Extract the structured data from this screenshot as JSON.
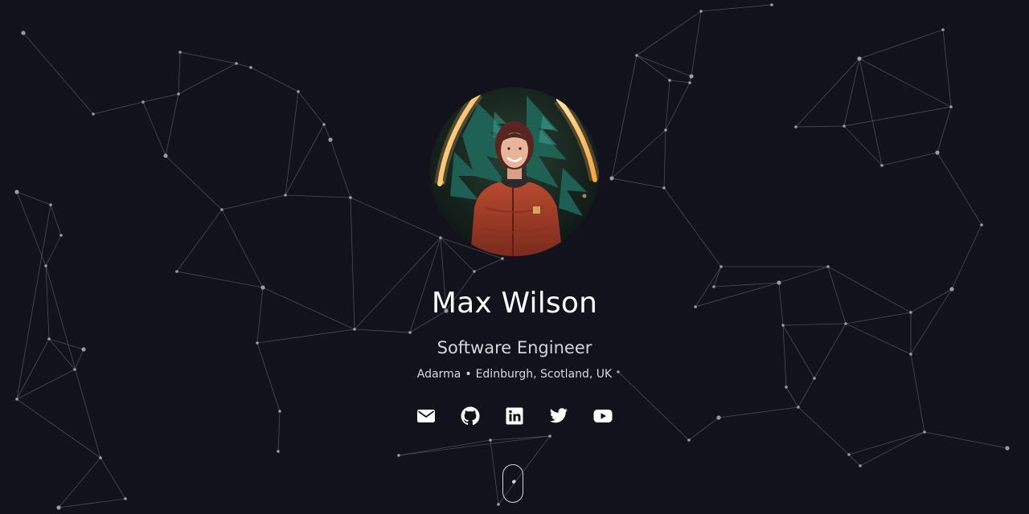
{
  "profile": {
    "name": "Max Wilson",
    "title": "Software Engineer",
    "company": "Adarma",
    "separator": "•",
    "location": "Edinburgh, Scotland, UK"
  },
  "social_links": [
    {
      "icon": "envelope-icon",
      "label": "Email"
    },
    {
      "icon": "github-icon",
      "label": "GitHub"
    },
    {
      "icon": "linkedin-icon",
      "label": "LinkedIn"
    },
    {
      "icon": "twitter-icon",
      "label": "Twitter"
    },
    {
      "icon": "youtube-icon",
      "label": "YouTube"
    }
  ],
  "colors": {
    "background": "#12121c",
    "text": "#ffffff",
    "muted_text": "#d4d4da",
    "network_line": "#5e5e6c",
    "network_node": "#9a9aa6"
  }
}
